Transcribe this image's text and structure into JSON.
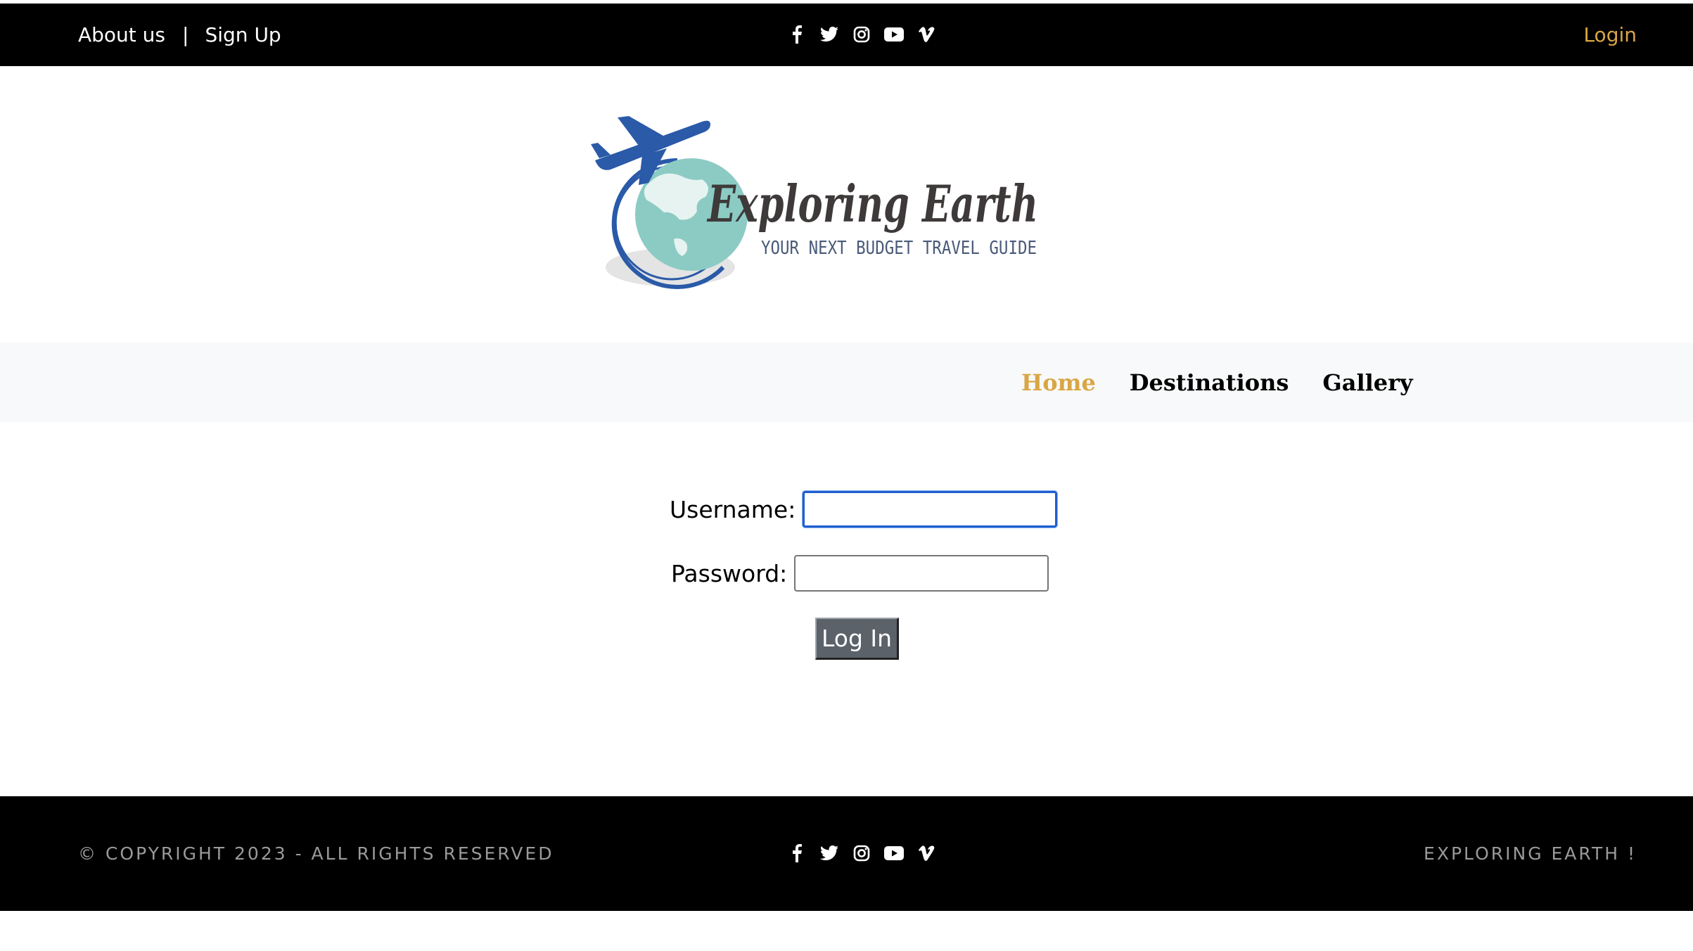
{
  "topbar": {
    "about_label": "About us",
    "separator": "|",
    "signup_label": "Sign Up",
    "login_label": "Login",
    "social_icons": [
      "facebook-icon",
      "twitter-icon",
      "instagram-icon",
      "youtube-icon",
      "vimeo-icon"
    ]
  },
  "logo": {
    "title": "Exploring Earth",
    "tagline": "YOUR NEXT BUDGET TRAVEL GUIDE"
  },
  "nav": {
    "items": [
      {
        "label": "Home",
        "active": true
      },
      {
        "label": "Destinations",
        "active": false
      },
      {
        "label": "Gallery",
        "active": false
      }
    ]
  },
  "form": {
    "username_label": "Username:",
    "username_value": "",
    "password_label": "Password:",
    "password_value": "",
    "submit_label": "Log In"
  },
  "footer": {
    "copyright": "© COPYRIGHT 2023 - ALL RIGHTS RESERVED",
    "brand": "EXPLORING EARTH !",
    "social_icons": [
      "facebook-icon",
      "twitter-icon",
      "instagram-icon",
      "youtube-icon",
      "vimeo-icon"
    ]
  },
  "colors": {
    "accent": "#d9a645",
    "bar_background": "#000000",
    "nav_background": "#f8f9fa",
    "button": "#5b626a",
    "focus_border": "#1f5fcf",
    "logo_blue": "#2a5aa8",
    "globe": "#8ccbc4"
  }
}
